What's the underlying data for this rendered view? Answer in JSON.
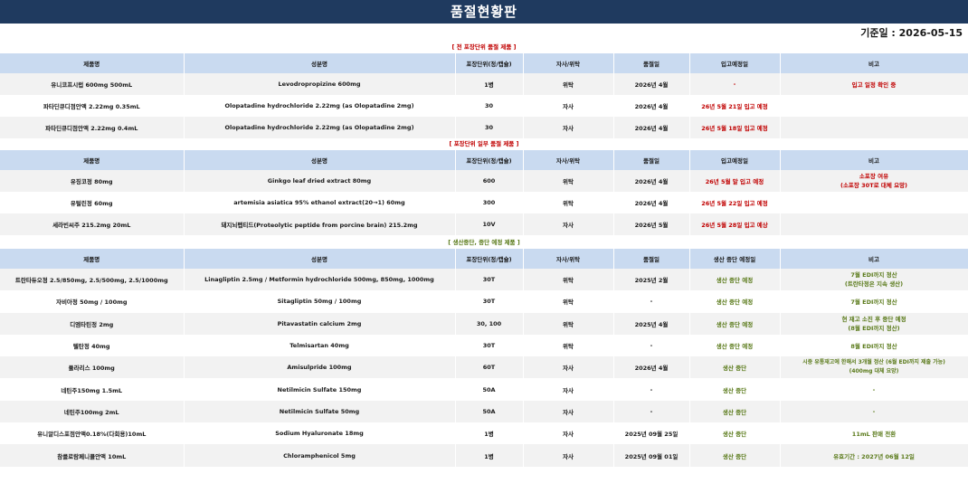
{
  "title": "품절현황판",
  "date_label": "기준일 : 2026-05-15",
  "sections": [
    {
      "label": "[ 전 포장단위 품절 제품 ]",
      "headers": [
        "제품명",
        "성분명",
        "포장단위(정/캡슐)",
        "자사/위탁",
        "품절일",
        "입고예정일",
        "비고"
      ],
      "rows": [
        [
          "유니코프시럽 600mg 500mL",
          "Levodropropizine 600mg",
          "1병",
          "위탁",
          "2026년 4월",
          "-",
          "입고 일정 확인 중"
        ],
        [
          "파타딘큐디점안액 2.22mg 0.35mL",
          "Olopatadine hydrochloride 2.22mg (as Olopatadine 2mg)",
          "30",
          "자사",
          "2026년 4월",
          "26년 5월 21일 입고 예정",
          ""
        ],
        [
          "파타딘큐디점안액 2.22mg 0.4mL",
          "Olopatadine hydrochloride 2.22mg (as Olopatadine 2mg)",
          "30",
          "자사",
          "2026년 4월",
          "26년 5월 18일 입고 예정",
          ""
        ]
      ]
    },
    {
      "label": "[ 포장단위 일부 품절 제품 ]",
      "headers": [
        "제품명",
        "성분명",
        "포장단위(정/캡슐)",
        "자사/위탁",
        "품절일",
        "입고예정일",
        "비고"
      ],
      "rows": [
        [
          "유징코정 80mg",
          "Ginkgo leaf dried extract 80mg",
          "600",
          "위탁",
          "2026년 4월",
          "26년 5월 말 입고 예정",
          "소포장 여유\n(소포장 30T로 대체 요망)"
        ],
        [
          "유털린정 60mg",
          "artemisia asiatica 95% ethanol extract(20→1) 60mg",
          "300",
          "위탁",
          "2026년 4월",
          "26년 5월 22일 입고 예정",
          ""
        ],
        [
          "세라빈씨주 215.2mg 20mL",
          "돼지뇌펩티드(Proteolytic peptide from porcine brain) 215.2mg",
          "10V",
          "자사",
          "2026년 5월",
          "26년 5월 28일 입고 예상",
          ""
        ]
      ]
    },
    {
      "label": "[ 생산중단, 중단 예정 제품 ]",
      "headers": [
        "제품명",
        "성분명",
        "포장단위(정/캡슐)",
        "자사/위탁",
        "품절일",
        "생산 중단 예정일",
        "비고"
      ],
      "rows": [
        [
          "트란타듀오정 2.5/850mg, 2.5/500mg, 2.5/1000mg",
          "Linagliptin 2.5mg / Metformin hydrochloride 500mg, 850mg, 1000mg",
          "30T",
          "위탁",
          "2025년 2월",
          "생산 중단 예정",
          "7월 EDI까지 정산\n(트란타정은 지속 생산)"
        ],
        [
          "자비아정 50mg / 100mg",
          "Sitagliptin 50mg / 100mg",
          "30T",
          "위탁",
          "-",
          "생산 중단 예정",
          "7월 EDI까지 정산"
        ],
        [
          "디엠타틴정 2mg",
          "Pitavastatin calcium 2mg",
          "30, 100",
          "위탁",
          "2025년 4월",
          "생산 중단 예정",
          "현 재고 소진 후 중단 예정\n(8월 EDI까지 정산)"
        ],
        [
          "텔탄정 40mg",
          "Telmisartan 40mg",
          "30T",
          "위탁",
          "-",
          "생산 중단 예정",
          "8월 EDI까지 정산"
        ],
        [
          "풀라리스 100mg",
          "Amisulpride 100mg",
          "60T",
          "자사",
          "2026년 4월",
          "생산 중단",
          "시중 유통재고에 한해서 3개월 정산 (6월 EDI까지 제출 가능)\n(400mg 대체 요망)"
        ],
        [
          "네틴주150mg 1.5mL",
          "Netilmicin Sulfate 150mg",
          "50A",
          "자사",
          "-",
          "생산 중단",
          "-"
        ],
        [
          "네틴주100mg 2mL",
          "Netilmicin Sulfate 50mg",
          "50A",
          "자사",
          "-",
          "생산 중단",
          "-"
        ],
        [
          "유니알디스포점안액0.18%(다회용)10mL",
          "Sodium Hyaluronate 18mg",
          "1병",
          "자사",
          "2025년 09월 25일",
          "생산 중단",
          "11mL 판매 전환"
        ],
        [
          "참클로람페니콜안액 10mL",
          "Chloramphenicol 5mg",
          "1병",
          "자사",
          "2025년 09월 01일",
          "생산 중단",
          "유효기간 : 2027년 06월 12일"
        ]
      ]
    }
  ]
}
